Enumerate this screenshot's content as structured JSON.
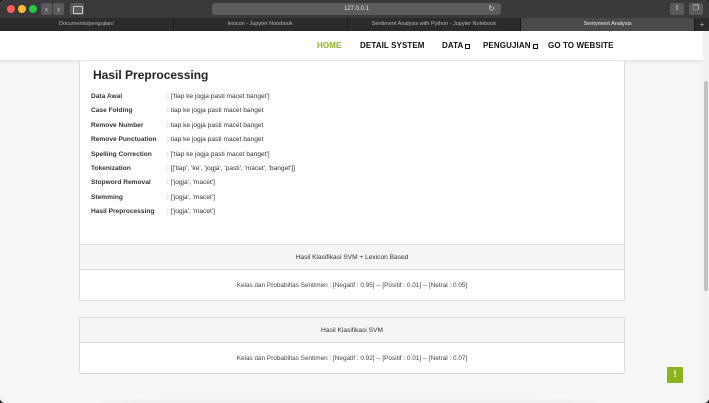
{
  "browser": {
    "url": "127.0.0.1",
    "tabs": [
      {
        "label": "Documents/pengujian/"
      },
      {
        "label": "lexicon - Jupyter Notebook"
      },
      {
        "label": "Sentiment Analysis with Python - Jupyter Notebook"
      },
      {
        "label": "Sentyment Analysis"
      }
    ]
  },
  "nav": {
    "home": "HOME",
    "detail": "DETAIL SYSTEM",
    "data": "DATA",
    "pengujian": "PENGUJIAN",
    "website": "GO TO WEBSITE"
  },
  "preprocessing": {
    "title": "Hasil Preprocessing",
    "rows": [
      {
        "label": "Data Awal",
        "value": ": ['tiap ke jogja pasti macet banget']"
      },
      {
        "label": "Case Folding",
        "value": ": tiap ke jogja pasti macet banget"
      },
      {
        "label": "Remove Number",
        "value": ": tiap ke jogja pasti macet banget"
      },
      {
        "label": "Remove Punctuation",
        "value": ": tiap ke jogja pasti macet banget"
      },
      {
        "label": "Spelling Correction",
        "value": ": ['tiap ke jogja pasti macet banget']"
      },
      {
        "label": "Tokenization",
        "value": ": [['tiap', 'ke', 'jogja', 'pasti', 'macet', 'banget']]"
      },
      {
        "label": "Stopword Removal",
        "value": ": ['jogja', 'macet']"
      },
      {
        "label": "Stemming",
        "value": ": ['jogja', 'macet']"
      },
      {
        "label": "Hasil Preprocessing",
        "value": ": ['jogja', 'macet']"
      }
    ]
  },
  "results": [
    {
      "title": "Hasil Klasifikasi SVM + Lexicon Based",
      "text": "Kelas dan Probabiltas Sentimen  :  [Negatif : 0.95] -- [Positif : 0.01] -- [Netral : 0.05]"
    },
    {
      "title": "Hasil Klasifikasi SVM",
      "text": "Kelas dan Probabiltas Sentimen  :  [Negatif : 0.92] -- [Positif : 0.01] -- [Netral : 0.07]"
    }
  ],
  "back_to_top": "!",
  "colors": {
    "accent": "#8bb51f"
  }
}
